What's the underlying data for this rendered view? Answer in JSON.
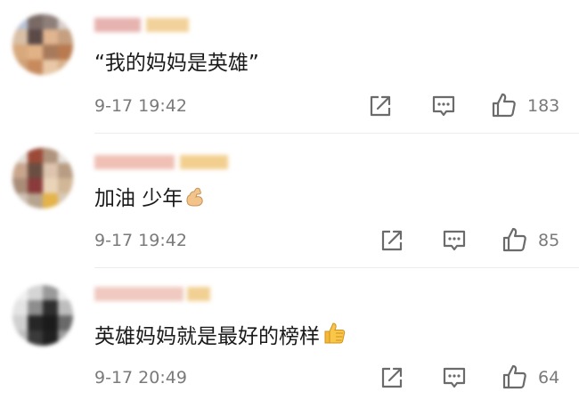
{
  "colors": {
    "text": "#1a1a1a",
    "meta": "#7a7a7a",
    "divider": "#ececec",
    "icon": "#6b6b6b"
  },
  "comments": [
    {
      "text": "“我的妈妈是英雄”",
      "time": "9-17 19:42",
      "likes": "183",
      "emoji": ""
    },
    {
      "text": "加油 少年",
      "time": "9-17 19:42",
      "likes": "85",
      "emoji": "flexed-biceps-icon"
    },
    {
      "text": "英雄妈妈就是最好的榜样",
      "time": "9-17 20:49",
      "likes": "64",
      "emoji": "thumbs-up-emoji-icon"
    }
  ],
  "icons": {
    "share": "share-icon",
    "reply": "comment-icon",
    "like": "thumbs-up-icon"
  }
}
